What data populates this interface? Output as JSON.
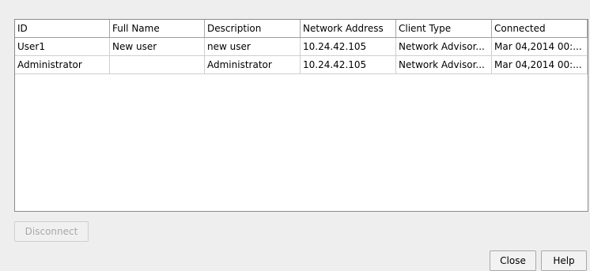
{
  "table": {
    "columns": [
      "ID",
      "Full Name",
      "Description",
      "Network Address",
      "Client Type",
      "Connected"
    ],
    "rows": [
      [
        "User1",
        "New user",
        "new user",
        "10.24.42.105",
        "Network Advisor...",
        "Mar 04,2014 00:..."
      ],
      [
        "Administrator",
        "",
        "Administrator",
        "10.24.42.105",
        "Network Advisor...",
        "Mar 04,2014 00:..."
      ]
    ]
  },
  "buttons": {
    "disconnect": "Disconnect",
    "close": "Close",
    "help": "Help"
  }
}
